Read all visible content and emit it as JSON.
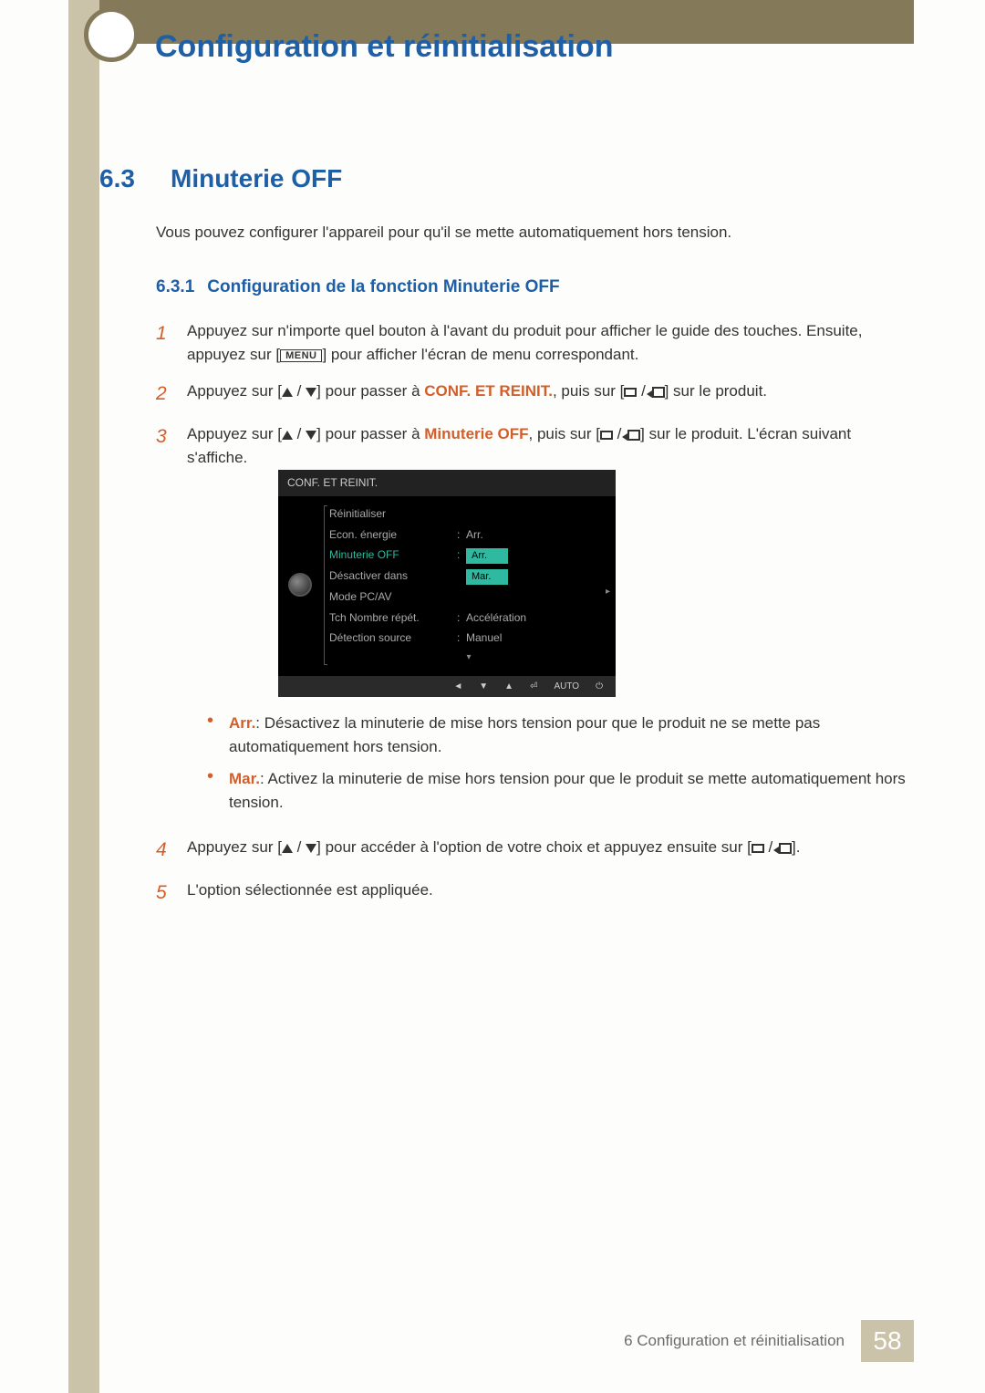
{
  "header": {
    "title": "Configuration et réinitialisation"
  },
  "section": {
    "number": "6.3",
    "title": "Minuterie OFF",
    "intro": "Vous pouvez configurer l'appareil pour qu'il se mette automatiquement hors tension."
  },
  "subsection": {
    "number": "6.3.1",
    "title": "Configuration de la fonction Minuterie OFF"
  },
  "steps": {
    "s1a": "Appuyez sur n'importe quel bouton à l'avant du produit pour afficher le guide des touches. Ensuite, appuyez sur [",
    "s1b": "] pour afficher l'écran de menu correspondant.",
    "menu_label": "MENU",
    "s2a": "Appuyez sur [",
    "s2b": "] pour passer à ",
    "conf": "CONF. ET REINIT.",
    "s2c": ", puis sur [",
    "s2d": "] sur le produit.",
    "s3a": "Appuyez sur [",
    "s3b": "] pour passer à ",
    "min": "Minuterie OFF",
    "s3c": ", puis sur [",
    "s3d": "] sur le produit. L'écran suivant s'affiche.",
    "bullet_arr_label": "Arr.",
    "bullet_arr_text": ": Désactivez la minuterie de mise hors tension pour que le produit ne se mette pas automatiquement hors tension.",
    "bullet_mar_label": "Mar.",
    "bullet_mar_text": ": Activez la minuterie de mise hors tension pour que le produit se mette automatiquement hors tension.",
    "s4a": "Appuyez sur [",
    "s4b": "] pour accéder à l'option de votre choix et appuyez ensuite sur [",
    "s4c": "].",
    "s5": "L'option sélectionnée est appliquée."
  },
  "osd": {
    "title": "CONF. ET REINIT.",
    "rows": [
      {
        "label": "Réinitialiser",
        "value": ""
      },
      {
        "label": "Econ. énergie",
        "value": "Arr."
      },
      {
        "label": "Minuterie OFF",
        "value": ""
      },
      {
        "label": "Désactiver dans",
        "value": ""
      },
      {
        "label": "Mode PC/AV",
        "value": ""
      },
      {
        "label": "Tch Nombre répét.",
        "value": "Accélération"
      },
      {
        "label": "Détection source",
        "value": "Manuel"
      }
    ],
    "popup": [
      "Arr.",
      "Mar."
    ],
    "foot_auto": "AUTO"
  },
  "footer": {
    "text": "6 Configuration et réinitialisation",
    "page": "58"
  }
}
